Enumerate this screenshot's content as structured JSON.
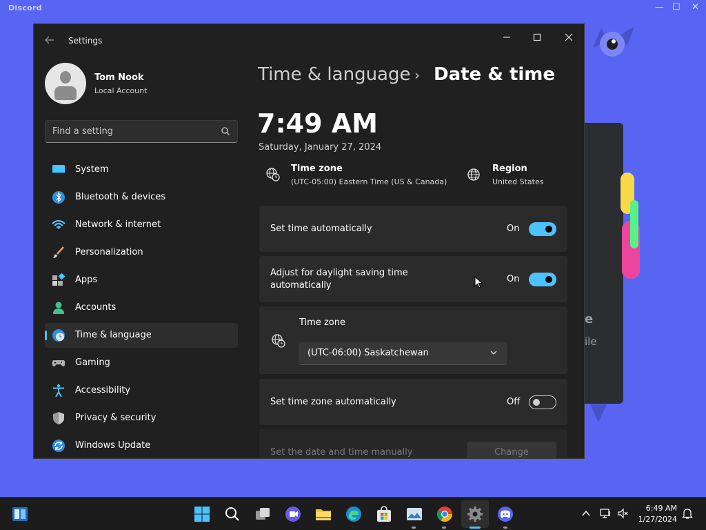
{
  "discord": {
    "title": "Discord",
    "partial_text_1": "e",
    "partial_text_2": "ile",
    "controls": [
      "—",
      "☐",
      "✕"
    ]
  },
  "window": {
    "app_title": "Settings"
  },
  "profile": {
    "name": "Tom Nook",
    "account_type": "Local Account"
  },
  "search": {
    "placeholder": "Find a setting"
  },
  "sidebar": {
    "items": [
      {
        "label": "System",
        "icon": "system-icon",
        "active": false
      },
      {
        "label": "Bluetooth & devices",
        "icon": "bluetooth-icon",
        "active": false
      },
      {
        "label": "Network & internet",
        "icon": "wifi-icon",
        "active": false
      },
      {
        "label": "Personalization",
        "icon": "brush-icon",
        "active": false
      },
      {
        "label": "Apps",
        "icon": "apps-icon",
        "active": false
      },
      {
        "label": "Accounts",
        "icon": "accounts-icon",
        "active": false
      },
      {
        "label": "Time & language",
        "icon": "time-language-icon",
        "active": true
      },
      {
        "label": "Gaming",
        "icon": "gamepad-icon",
        "active": false
      },
      {
        "label": "Accessibility",
        "icon": "accessibility-icon",
        "active": false
      },
      {
        "label": "Privacy & security",
        "icon": "shield-icon",
        "active": false
      },
      {
        "label": "Windows Update",
        "icon": "update-icon",
        "active": false
      }
    ]
  },
  "breadcrumb": {
    "parent": "Time & language",
    "separator": "›",
    "current": "Date & time"
  },
  "clock": {
    "time": "7:49 AM",
    "date": "Saturday, January 27, 2024"
  },
  "summary": {
    "timezone_title": "Time zone",
    "timezone_value": "(UTC-05:00) Eastern Time (US & Canada)",
    "region_title": "Region",
    "region_value": "United States"
  },
  "settings": {
    "set_time_auto": {
      "label": "Set time automatically",
      "state": "On",
      "on": true
    },
    "dst_auto": {
      "label_line1": "Adjust for daylight saving time",
      "label_line2": "automatically",
      "state": "On",
      "on": true
    },
    "timezone_card": {
      "label": "Time zone",
      "selected": "(UTC-06:00) Saskatchewan"
    },
    "set_tz_auto": {
      "label": "Set time zone automatically",
      "state": "Off",
      "on": false
    },
    "manual": {
      "label": "Set the date and time manually",
      "button": "Change"
    }
  },
  "taskbar": {
    "time": "6:49 AM",
    "date": "1/27/2024"
  },
  "colors": {
    "accent": "#4cc2ff",
    "discord_blurple": "#5865f2",
    "window_bg": "#202020",
    "card_bg": "#2b2b2b"
  }
}
